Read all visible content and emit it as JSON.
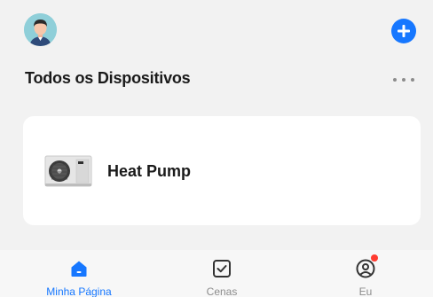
{
  "header": {
    "avatar_icon": "user-avatar-icon",
    "add_icon": "plus-circle-icon",
    "accent_color": "#1677ff"
  },
  "section": {
    "title": "Todos os Dispositivos",
    "more_icon": "more-dots-icon"
  },
  "devices": [
    {
      "name": "Heat Pump",
      "icon": "heat-pump-unit-image"
    }
  ],
  "bottom_nav": {
    "items": [
      {
        "label": "Minha Página",
        "icon": "home-icon",
        "active": true
      },
      {
        "label": "Cenas",
        "icon": "checkbox-icon",
        "active": false
      },
      {
        "label": "Eu",
        "icon": "user-circle-icon",
        "active": false,
        "has_notification_dot": true
      }
    ]
  }
}
